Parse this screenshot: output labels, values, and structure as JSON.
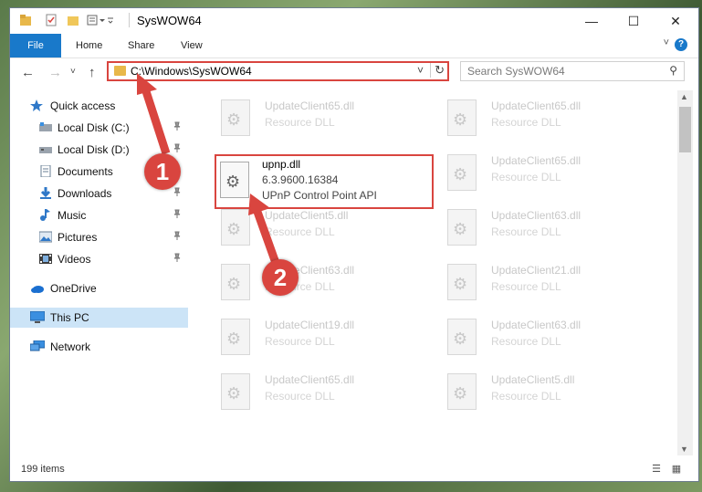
{
  "window": {
    "title": "SysWOW64",
    "qa_toolbar_icons": [
      "folder-icon",
      "properties-icon",
      "new-folder-icon",
      "customize-icon"
    ],
    "controls": {
      "minimize": "—",
      "maximize": "☐",
      "close": "✕"
    }
  },
  "ribbon": {
    "tabs": [
      "File",
      "Home",
      "Share",
      "View"
    ],
    "expand": "˅",
    "help": "?"
  },
  "address": {
    "back": "←",
    "forward": "→",
    "recent": "˅",
    "up": "↑",
    "path": "C:\\Windows\\SysWOW64",
    "dropdown": "˅",
    "refresh": "↻"
  },
  "search": {
    "placeholder": "Search SysWOW64",
    "icon": "⚲"
  },
  "nav": {
    "items": [
      {
        "label": "Quick access",
        "icon": "star-icon",
        "pinned": false
      },
      {
        "label": "Local Disk (C:)",
        "icon": "drive-icon",
        "pinned": true
      },
      {
        "label": "Local Disk (D:)",
        "icon": "drive-icon",
        "pinned": true
      },
      {
        "label": "Documents",
        "icon": "documents-icon",
        "pinned": true
      },
      {
        "label": "Downloads",
        "icon": "downloads-icon",
        "pinned": true
      },
      {
        "label": "Music",
        "icon": "music-icon",
        "pinned": true
      },
      {
        "label": "Pictures",
        "icon": "pictures-icon",
        "pinned": true
      },
      {
        "label": "Videos",
        "icon": "videos-icon",
        "pinned": true
      },
      {
        "label": "OneDrive",
        "icon": "onedrive-icon",
        "pinned": false
      },
      {
        "label": "This PC",
        "icon": "computer-icon",
        "pinned": false
      },
      {
        "label": "Network",
        "icon": "network-icon",
        "pinned": false
      }
    ],
    "pin_glyph": "📌"
  },
  "files": {
    "left": [
      {
        "name": "UpdateClient65.dll",
        "type": "Resource DLL"
      },
      {
        "name": "upnp.dll",
        "version": "6.3.9600.16384",
        "type": "UPnP Control Point API"
      },
      {
        "name": "UpdateClient5.dll",
        "type": "Resource DLL"
      },
      {
        "name": "UpdateClient63.dll",
        "type": "Resource DLL"
      },
      {
        "name": "UpdateClient19.dll",
        "type": "Resource DLL"
      },
      {
        "name": "UpdateClient65.dll",
        "type": "Resource DLL"
      }
    ],
    "right": [
      {
        "name": "UpdateClient65.dll",
        "type": "Resource DLL"
      },
      {
        "name": "UpdateClient65.dll",
        "type": "Resource DLL"
      },
      {
        "name": "UpdateClient63.dll",
        "type": "Resource DLL"
      },
      {
        "name": "UpdateClient21.dll",
        "type": "Resource DLL"
      },
      {
        "name": "UpdateClient63.dll",
        "type": "Resource DLL"
      },
      {
        "name": "UpdateClient5.dll",
        "type": "Resource DLL"
      }
    ]
  },
  "status": {
    "count": "199 items",
    "details_view": "☰",
    "tiles_view": "▦"
  },
  "annotations": {
    "step1": "1",
    "step2": "2",
    "accent": "#d9453f"
  }
}
